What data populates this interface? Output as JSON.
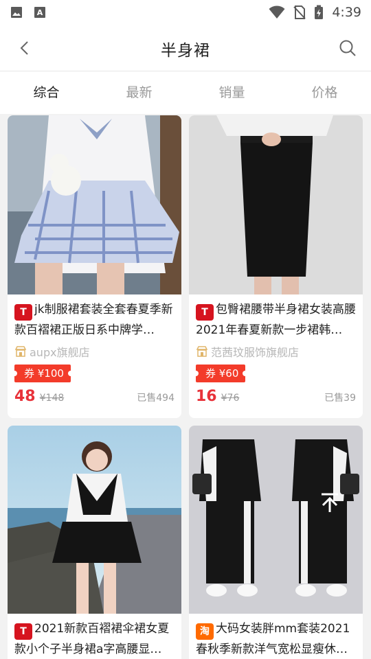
{
  "status_bar": {
    "time": "4:39",
    "left_icons": [
      "gallery-icon",
      "font-icon"
    ],
    "right_icons": [
      "wifi-icon",
      "no-sim-icon",
      "battery-charging-icon"
    ]
  },
  "app_bar": {
    "title": "半身裙",
    "back_icon": "chevron-left-icon",
    "search_icon": "search-icon"
  },
  "tabs": [
    {
      "label": "综合",
      "active": true
    },
    {
      "label": "最新",
      "active": false
    },
    {
      "label": "销量",
      "active": false
    },
    {
      "label": "价格",
      "active": false
    }
  ],
  "products": [
    {
      "platform": "T",
      "platform_type": "tmall",
      "title": "jk制服裙套装全套春夏季新款百褶裙正版日系中牌学…",
      "shop": "aupx旗舰店",
      "coupon": "券 ¥100",
      "price": "48",
      "original_price": "¥148",
      "sold": "已售494"
    },
    {
      "platform": "T",
      "platform_type": "tmall",
      "title": "包臀裙腰带半身裙女装高腰2021年春夏新款一步裙韩…",
      "shop": "范茜玟服饰旗舰店",
      "coupon": "券 ¥60",
      "price": "16",
      "original_price": "¥76",
      "sold": "已售39"
    },
    {
      "platform": "T",
      "platform_type": "tmall",
      "title": "2021新款百褶裙伞裙女夏款小个子半身裙a字高腰显…"
    },
    {
      "platform": "淘",
      "platform_type": "taobao",
      "title": "大码女装胖mm套装2021春秋季新款洋气宽松显瘦休…"
    }
  ],
  "colors": {
    "accent_red": "#e8323a",
    "coupon_red": "#f33b2a",
    "tmall_red": "#d6141f",
    "taobao_orange": "#ff6a00"
  },
  "floating": {
    "icon": "arrow-to-top-icon"
  }
}
